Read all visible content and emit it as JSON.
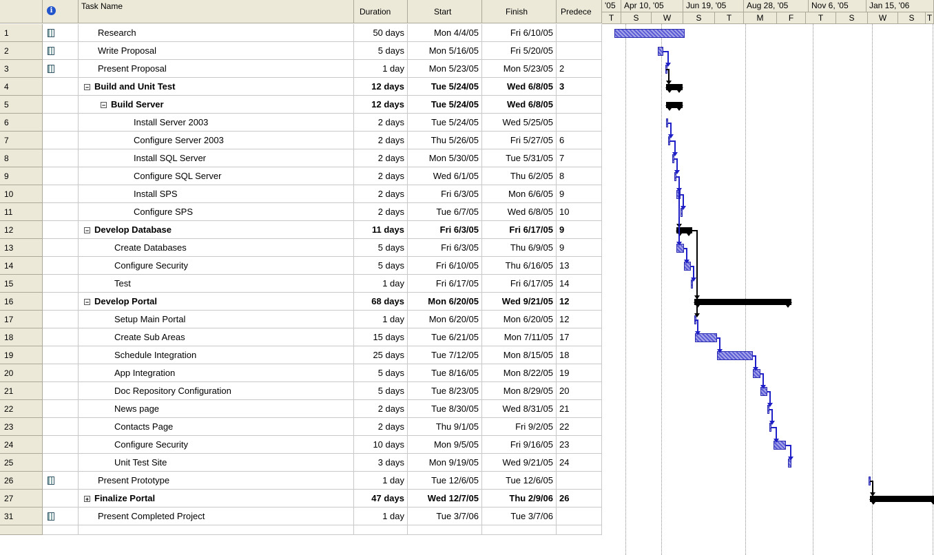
{
  "columns": {
    "info_icon": "i",
    "task_name": "Task Name",
    "duration": "Duration",
    "start": "Start",
    "finish": "Finish",
    "predecessors": "Predece"
  },
  "timescale": {
    "major": [
      "'05",
      "Apr 10, '05",
      "Jun 19, '05",
      "Aug 28, '05",
      "Nov 6, '05",
      "Jan 15, '06"
    ],
    "minor": [
      "T",
      "S",
      "W",
      "S",
      "T",
      "M",
      "F",
      "T",
      "S",
      "W",
      "S",
      "T"
    ]
  },
  "tasks": [
    {
      "id": "1",
      "icon": "calendar-icon",
      "name": "Research",
      "level": 0,
      "type": "task",
      "duration": "50 days",
      "start": "Mon 4/4/05",
      "finish": "Fri 6/10/05",
      "pred": ""
    },
    {
      "id": "2",
      "icon": "calendar-icon",
      "name": "Write Proposal",
      "level": 0,
      "type": "task",
      "duration": "5 days",
      "start": "Mon 5/16/05",
      "finish": "Fri 5/20/05",
      "pred": ""
    },
    {
      "id": "3",
      "icon": "calendar-icon",
      "name": "Present Proposal",
      "level": 0,
      "type": "task",
      "duration": "1 day",
      "start": "Mon 5/23/05",
      "finish": "Mon 5/23/05",
      "pred": "2"
    },
    {
      "id": "4",
      "icon": "",
      "name": "Build and Unit Test",
      "level": 0,
      "type": "summary",
      "toggle": "−",
      "duration": "12 days",
      "start": "Tue 5/24/05",
      "finish": "Wed 6/8/05",
      "pred": "3"
    },
    {
      "id": "5",
      "icon": "",
      "name": "Build Server",
      "level": 1,
      "type": "summary",
      "toggle": "−",
      "duration": "12 days",
      "start": "Tue 5/24/05",
      "finish": "Wed 6/8/05",
      "pred": ""
    },
    {
      "id": "6",
      "icon": "",
      "name": "Install Server 2003",
      "level": 2,
      "type": "task",
      "duration": "2 days",
      "start": "Tue 5/24/05",
      "finish": "Wed 5/25/05",
      "pred": ""
    },
    {
      "id": "7",
      "icon": "",
      "name": "Configure Server 2003",
      "level": 2,
      "type": "task",
      "duration": "2 days",
      "start": "Thu 5/26/05",
      "finish": "Fri 5/27/05",
      "pred": "6"
    },
    {
      "id": "8",
      "icon": "",
      "name": "Install SQL Server",
      "level": 2,
      "type": "task",
      "duration": "2 days",
      "start": "Mon 5/30/05",
      "finish": "Tue 5/31/05",
      "pred": "7"
    },
    {
      "id": "9",
      "icon": "",
      "name": "Configure SQL Server",
      "level": 2,
      "type": "task",
      "duration": "2 days",
      "start": "Wed 6/1/05",
      "finish": "Thu 6/2/05",
      "pred": "8"
    },
    {
      "id": "10",
      "icon": "",
      "name": "Install SPS",
      "level": 2,
      "type": "task",
      "duration": "2 days",
      "start": "Fri 6/3/05",
      "finish": "Mon 6/6/05",
      "pred": "9"
    },
    {
      "id": "11",
      "icon": "",
      "name": "Configure SPS",
      "level": 2,
      "type": "task",
      "duration": "2 days",
      "start": "Tue 6/7/05",
      "finish": "Wed 6/8/05",
      "pred": "10"
    },
    {
      "id": "12",
      "icon": "",
      "name": "Develop Database",
      "level": 0,
      "type": "summary",
      "toggle": "−",
      "duration": "11 days",
      "start": "Fri 6/3/05",
      "finish": "Fri 6/17/05",
      "pred": "9"
    },
    {
      "id": "13",
      "icon": "",
      "name": "Create Databases",
      "level": 1,
      "type": "task",
      "duration": "5 days",
      "start": "Fri 6/3/05",
      "finish": "Thu 6/9/05",
      "pred": "9"
    },
    {
      "id": "14",
      "icon": "",
      "name": "Configure Security",
      "level": 1,
      "type": "task",
      "duration": "5 days",
      "start": "Fri 6/10/05",
      "finish": "Thu 6/16/05",
      "pred": "13"
    },
    {
      "id": "15",
      "icon": "",
      "name": "Test",
      "level": 1,
      "type": "task",
      "duration": "1 day",
      "start": "Fri 6/17/05",
      "finish": "Fri 6/17/05",
      "pred": "14"
    },
    {
      "id": "16",
      "icon": "",
      "name": "Develop Portal",
      "level": 0,
      "type": "summary",
      "toggle": "−",
      "duration": "68 days",
      "start": "Mon 6/20/05",
      "finish": "Wed 9/21/05",
      "pred": "12"
    },
    {
      "id": "17",
      "icon": "",
      "name": "Setup Main Portal",
      "level": 1,
      "type": "task",
      "duration": "1 day",
      "start": "Mon 6/20/05",
      "finish": "Mon 6/20/05",
      "pred": "12"
    },
    {
      "id": "18",
      "icon": "",
      "name": "Create Sub Areas",
      "level": 1,
      "type": "task",
      "duration": "15 days",
      "start": "Tue 6/21/05",
      "finish": "Mon 7/11/05",
      "pred": "17"
    },
    {
      "id": "19",
      "icon": "",
      "name": "Schedule Integration",
      "level": 1,
      "type": "task",
      "duration": "25 days",
      "start": "Tue 7/12/05",
      "finish": "Mon 8/15/05",
      "pred": "18"
    },
    {
      "id": "20",
      "icon": "",
      "name": "App Integration",
      "level": 1,
      "type": "task",
      "duration": "5 days",
      "start": "Tue 8/16/05",
      "finish": "Mon 8/22/05",
      "pred": "19"
    },
    {
      "id": "21",
      "icon": "",
      "name": "Doc Repository Configuration",
      "level": 1,
      "type": "task",
      "duration": "5 days",
      "start": "Tue 8/23/05",
      "finish": "Mon 8/29/05",
      "pred": "20"
    },
    {
      "id": "22",
      "icon": "",
      "name": "News page",
      "level": 1,
      "type": "task",
      "duration": "2 days",
      "start": "Tue 8/30/05",
      "finish": "Wed 8/31/05",
      "pred": "21"
    },
    {
      "id": "23",
      "icon": "",
      "name": "Contacts Page",
      "level": 1,
      "type": "task",
      "duration": "2 days",
      "start": "Thu 9/1/05",
      "finish": "Fri 9/2/05",
      "pred": "22"
    },
    {
      "id": "24",
      "icon": "",
      "name": "Configure Security",
      "level": 1,
      "type": "task",
      "duration": "10 days",
      "start": "Mon 9/5/05",
      "finish": "Fri 9/16/05",
      "pred": "23"
    },
    {
      "id": "25",
      "icon": "",
      "name": "Unit Test Site",
      "level": 1,
      "type": "task",
      "duration": "3 days",
      "start": "Mon 9/19/05",
      "finish": "Wed 9/21/05",
      "pred": "24"
    },
    {
      "id": "26",
      "icon": "calendar-icon",
      "name": "Present Prototype",
      "level": 0,
      "type": "task",
      "duration": "1 day",
      "start": "Tue 12/6/05",
      "finish": "Tue 12/6/05",
      "pred": ""
    },
    {
      "id": "27",
      "icon": "",
      "name": "Finalize Portal",
      "level": 0,
      "type": "summary",
      "toggle": "+",
      "duration": "47 days",
      "start": "Wed 12/7/05",
      "finish": "Thu 2/9/06",
      "pred": "26"
    },
    {
      "id": "31",
      "icon": "calendar-icon",
      "name": "Present Completed Project",
      "level": 0,
      "type": "task",
      "duration": "1 day",
      "start": "Tue 3/7/06",
      "finish": "Tue 3/7/06",
      "pred": ""
    }
  ]
}
